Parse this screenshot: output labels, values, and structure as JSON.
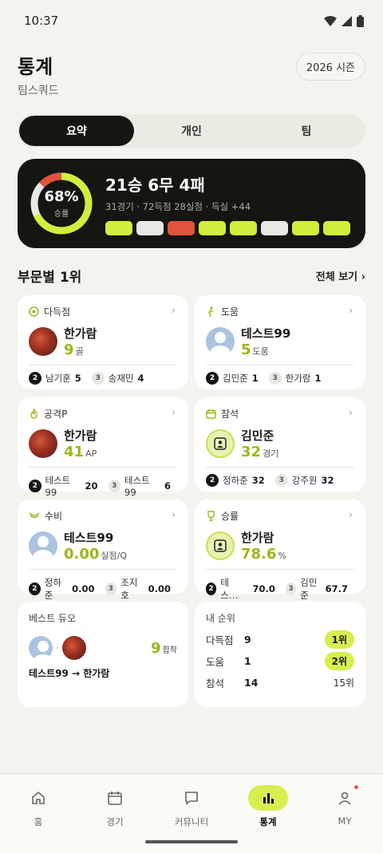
{
  "status": {
    "time": "10:37"
  },
  "header": {
    "title": "통계",
    "subtitle": "팀스쿼드",
    "season": "2026 시즌"
  },
  "tabs": [
    {
      "label": "요약"
    },
    {
      "label": "개인"
    },
    {
      "label": "팀"
    }
  ],
  "summary": {
    "win_rate": "68%",
    "win_rate_label": "승률",
    "record": "21승 6무 4패",
    "sub": "31경기 · 72득점 28실점 · 득실 +44",
    "form": [
      "W",
      "D",
      "L",
      "W",
      "W",
      "D",
      "W",
      "W"
    ],
    "colors": {
      "win": "#d2ed3c",
      "draw": "#e8e8e2",
      "loss": "#e2533d"
    }
  },
  "section": {
    "title": "부문별 1위",
    "more": "전체 보기 ›"
  },
  "cards": [
    {
      "title": "다득점",
      "name": "한가람",
      "value": "9",
      "unit": "골",
      "r2_name": "남기훈",
      "r2_val": "5",
      "r3_name": "송재민",
      "r3_val": "4"
    },
    {
      "title": "도움",
      "name": "테스트99",
      "value": "5",
      "unit": "도움",
      "r2_name": "김민준",
      "r2_val": "1",
      "r3_name": "한가람",
      "r3_val": "1"
    },
    {
      "title": "공격P",
      "name": "한가람",
      "value": "41",
      "unit": "AP",
      "r2_name": "테스트99",
      "r2_val": "20",
      "r3_name": "테스트99",
      "r3_val": "6"
    },
    {
      "title": "참석",
      "name": "김민준",
      "value": "32",
      "unit": "경기",
      "r2_name": "정하준",
      "r2_val": "32",
      "r3_name": "강주원",
      "r3_val": "32"
    },
    {
      "title": "수비",
      "name": "테스트99",
      "value": "0.00",
      "unit": "실점/Q",
      "r2_name": "정하준",
      "r2_val": "0.00",
      "r3_name": "조지호",
      "r3_val": "0.00"
    },
    {
      "title": "승률",
      "name": "한가람",
      "value": "78.6",
      "unit": "%",
      "r2_name": "테스…",
      "r2_val": "70.0",
      "r3_name": "김민준",
      "r3_val": "67.7"
    }
  ],
  "rank_nums": {
    "second": "2",
    "third": "3"
  },
  "duo": {
    "title": "베스트 듀오",
    "count": "9",
    "count_unit": "합작",
    "names": "테스트99 → 한가람"
  },
  "myrank": {
    "title": "내 순위",
    "rows": [
      {
        "label": "다득점",
        "value": "9",
        "rank": "1위"
      },
      {
        "label": "도움",
        "value": "1",
        "rank": "2위"
      },
      {
        "label": "참석",
        "value": "14",
        "rank": "15위"
      }
    ]
  },
  "nav": [
    {
      "label": "홈"
    },
    {
      "label": "경기"
    },
    {
      "label": "커뮤니티"
    },
    {
      "label": "통계"
    },
    {
      "label": "MY"
    }
  ]
}
